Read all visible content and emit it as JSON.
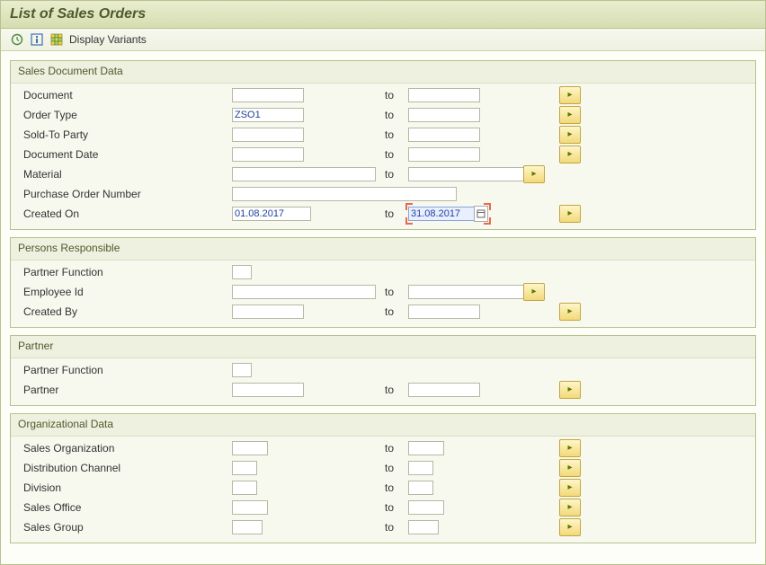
{
  "title": "List of Sales Orders",
  "toolbar": {
    "display_variants": "Display Variants"
  },
  "common": {
    "to": "to"
  },
  "groups": {
    "sales_doc": {
      "title": "Sales Document Data",
      "document": "Document",
      "order_type": "Order Type",
      "order_type_val": "ZSO1",
      "sold_to": "Sold-To Party",
      "doc_date": "Document Date",
      "material": "Material",
      "po_number": "Purchase Order Number",
      "created_on": "Created On",
      "created_on_from": "01.08.2017",
      "created_on_to": "31.08.2017"
    },
    "persons": {
      "title": "Persons Responsible",
      "partner_function": "Partner Function",
      "employee_id": "Employee Id",
      "created_by": "Created By"
    },
    "partner": {
      "title": "Partner",
      "partner_function": "Partner Function",
      "partner": "Partner"
    },
    "org": {
      "title": "Organizational Data",
      "sales_org": "Sales Organization",
      "dist_channel": "Distribution Channel",
      "division": "Division",
      "sales_office": "Sales Office",
      "sales_group": "Sales Group"
    }
  }
}
